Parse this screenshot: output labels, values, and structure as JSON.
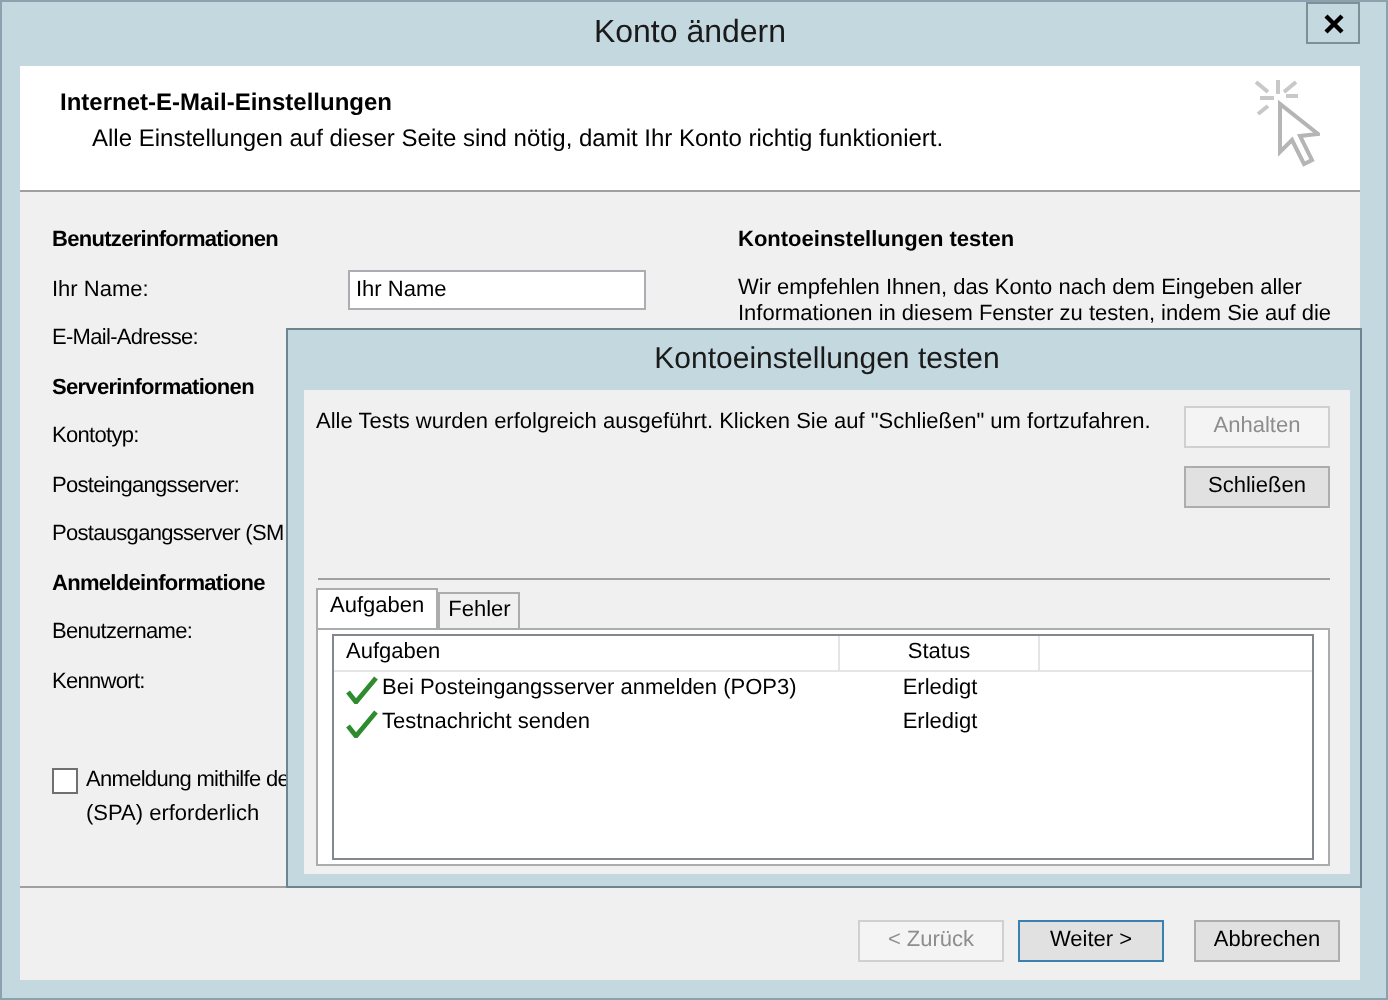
{
  "window": {
    "title": "Konto ändern"
  },
  "header": {
    "title": "Internet-E-Mail-Einstellungen",
    "subtitle": "Alle Einstellungen auf dieser Seite sind nötig, damit Ihr Konto richtig funktioniert."
  },
  "left_rows": [
    {
      "kind": "heading",
      "label": "Benutzerinformationen"
    },
    {
      "kind": "field",
      "label": "Ihr Name:",
      "value": "Ihr Name"
    },
    {
      "kind": "label",
      "label": "E-Mail-Adresse:"
    },
    {
      "kind": "heading",
      "label": "Serverinformationen"
    },
    {
      "kind": "label",
      "label": "Kontotyp:"
    },
    {
      "kind": "label",
      "label": "Posteingangsserver:"
    },
    {
      "kind": "label",
      "label": "Postausgangsserver (SM"
    },
    {
      "kind": "heading",
      "label": "Anmeldeinformatione"
    },
    {
      "kind": "label",
      "label": "Benutzername:"
    },
    {
      "kind": "label",
      "label": "Kennwort:"
    }
  ],
  "spa_checkbox": {
    "label": "Anmeldung mithilfe de",
    "label_line_2": "(SPA) erforderlich",
    "checked": false
  },
  "test_section": {
    "title": "Kontoeinstellungen testen",
    "text_lines": [
      "Wir empfehlen Ihnen, das Konto nach dem Eingeben aller",
      "Informationen in diesem Fenster zu testen, indem Sie auf die"
    ]
  },
  "footer_buttons": [
    {
      "label": "< Zurück",
      "disabled": true,
      "default": false
    },
    {
      "label": "Weiter >",
      "disabled": false,
      "default": true
    },
    {
      "label": "Abbrechen",
      "disabled": false,
      "default": false
    }
  ],
  "dialog": {
    "title": "Kontoeinstellungen testen",
    "message": "Alle Tests wurden erfolgreich ausgeführt. Klicken Sie auf \"Schließen\" um fortzufahren.",
    "buttons": [
      {
        "label": "Anhalten",
        "disabled": true
      },
      {
        "label": "Schließen",
        "disabled": false
      }
    ],
    "tabs": [
      {
        "label": "Aufgaben",
        "selected": true
      },
      {
        "label": "Fehler",
        "selected": false
      }
    ],
    "table": {
      "columns": [
        "Aufgaben",
        "Status"
      ],
      "rows": [
        {
          "task": "Bei Posteingangsserver anmelden (POP3)",
          "status": "Erledigt",
          "done": true
        },
        {
          "task": "Testnachricht senden",
          "status": "Erledigt",
          "done": true
        }
      ]
    }
  }
}
